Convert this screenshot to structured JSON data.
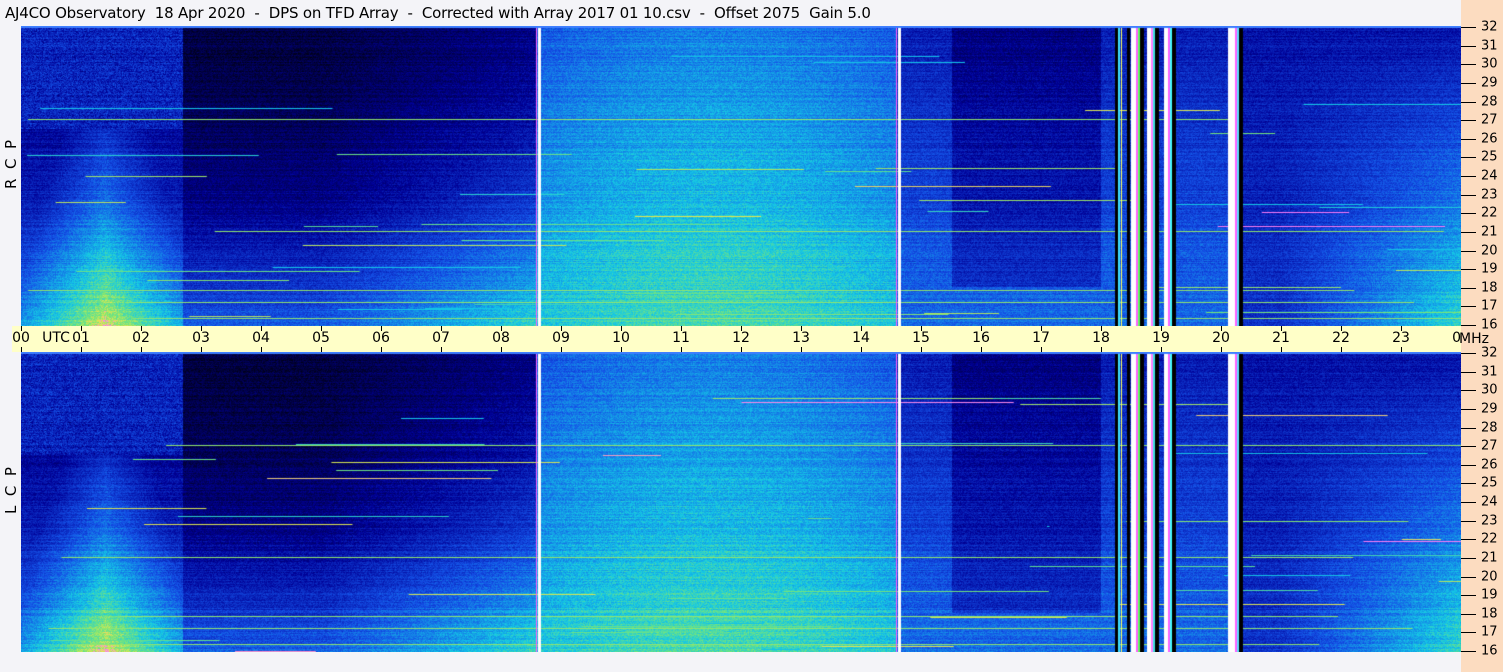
{
  "title": "AJ4CO Observatory  18 Apr 2020  -  DPS on TFD Array  -  Corrected with Array 2017 01 10.csv  -  Offset 2075  Gain 5.0",
  "channels": [
    {
      "label": "R  C  P"
    },
    {
      "label": "L  C  P"
    }
  ],
  "colors": {
    "title_bg": "#f4f4f8",
    "time_bar": "#ffffc8",
    "freq_bar": "#fcdcc0"
  },
  "chart_data": {
    "type": "heatmap",
    "title": "AJ4CO Observatory  18 Apr 2020  -  DPS on TFD Array  -  Corrected with Array 2017 01 10.csv  -  Offset 2075  Gain 5.0",
    "xlabel": "UTC",
    "ylabel": "MHz",
    "xlim": [
      0,
      24
    ],
    "ylim": [
      16,
      32
    ],
    "x_ticks": [
      "00",
      "01",
      "02",
      "03",
      "04",
      "05",
      "06",
      "07",
      "08",
      "09",
      "10",
      "11",
      "12",
      "13",
      "14",
      "15",
      "16",
      "17",
      "18",
      "19",
      "20",
      "21",
      "22",
      "23",
      "00"
    ],
    "y_ticks": [
      "16",
      "17",
      "18",
      "19",
      "20",
      "21",
      "22",
      "23",
      "24",
      "25",
      "26",
      "27",
      "28",
      "29",
      "30",
      "31",
      "32"
    ],
    "panels": [
      "RCP",
      "LCP"
    ],
    "colormap": [
      "#000000",
      "#0000a0",
      "#1450e6",
      "#14c8e6",
      "#78e678",
      "#e6e650",
      "#ff40ff",
      "#ffffff"
    ],
    "interference_lines_utc": [
      8.62,
      14.62,
      18.3,
      18.45,
      18.75,
      19.05,
      20.25
    ]
  }
}
